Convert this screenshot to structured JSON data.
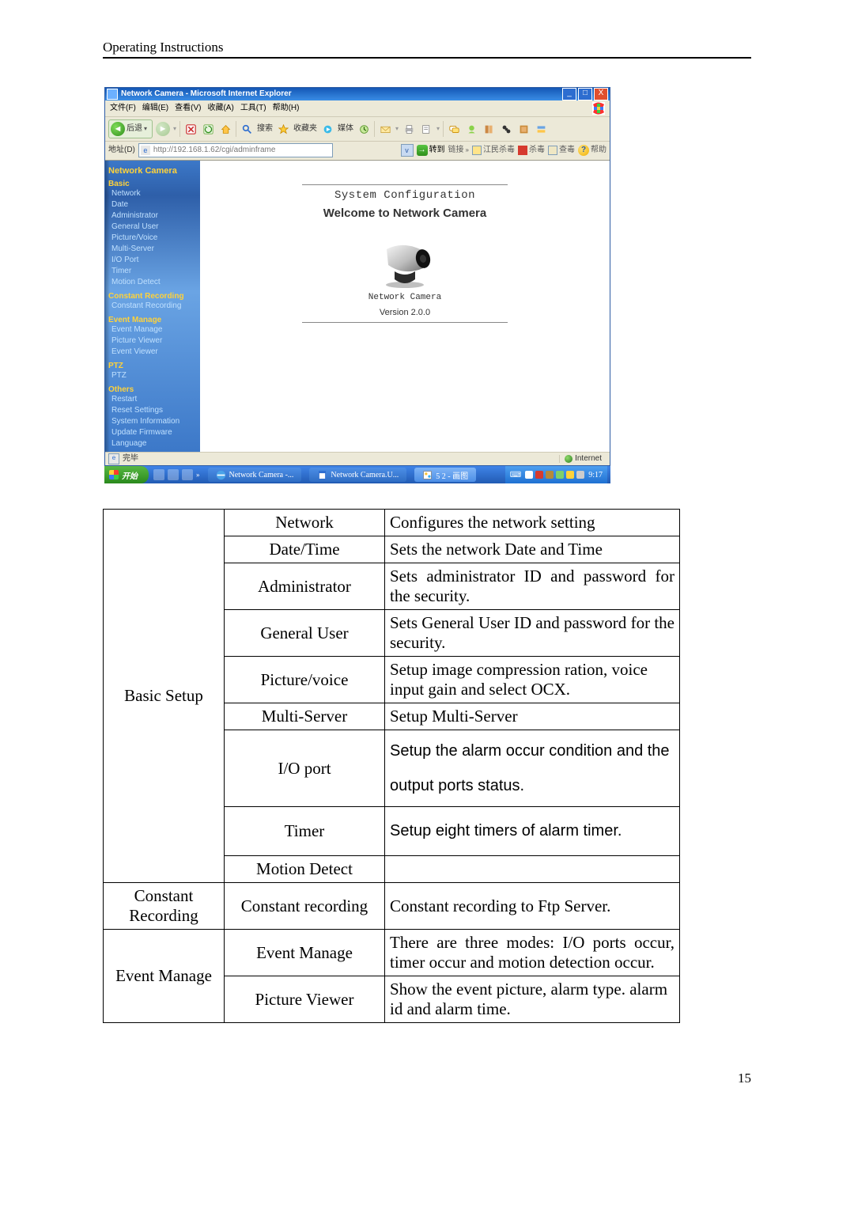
{
  "doc_header": "Operating Instructions",
  "page_number": "15",
  "window_title": "Network Camera - Microsoft Internet Explorer",
  "menu": {
    "file": "文件(F)",
    "edit": "编辑(E)",
    "view": "查看(V)",
    "fav": "收藏(A)",
    "tools": "工具(T)",
    "help": "帮助(H)"
  },
  "toolbar": {
    "back": "后退",
    "search": "搜索",
    "fav": "收藏夹",
    "media": "媒体"
  },
  "address": {
    "label": "地址(D)",
    "url": "http://192.168.1.62/cgi/adminframe",
    "go": "转到",
    "links": "链接",
    "jiang": "江民杀毒",
    "sha": "杀毒",
    "chak": "查毒",
    "help": "帮助"
  },
  "sidebar": {
    "title": "Network Camera",
    "sections": [
      {
        "header": "Basic",
        "items": [
          "Network",
          "Date",
          "Administrator",
          "General User",
          "Picture/Voice",
          "Multi-Server",
          "I/O Port",
          "Timer",
          "Motion Detect"
        ]
      },
      {
        "header": "Constant Recording",
        "items": [
          "Constant Recording"
        ]
      },
      {
        "header": "Event Manage",
        "items": [
          "Event Manage",
          "Picture Viewer",
          "Event Viewer"
        ]
      },
      {
        "header": "PTZ",
        "items": [
          "PTZ"
        ]
      },
      {
        "header": "Others",
        "items": [
          "Restart",
          "Reset Settings",
          "System Information",
          "Update Firmware",
          "Language"
        ]
      }
    ]
  },
  "main": {
    "title": "System Configuration",
    "welcome": "Welcome to Network Camera",
    "caption": "Network Camera",
    "version": "Version 2.0.0"
  },
  "status": {
    "done": "完毕",
    "zone": "Internet"
  },
  "taskbar": {
    "start": "开始",
    "task1": "Network Camera -...",
    "task2": "Network Camera.U...",
    "task3": "5 2 - 画图",
    "clock": "9:17"
  },
  "table": {
    "rows": [
      {
        "group": "Basic Setup",
        "item": "Network",
        "desc": "Configures the network setting"
      },
      {
        "group": "Basic Setup",
        "item": "Date/Time",
        "desc": "Sets the network Date and Time"
      },
      {
        "group": "Basic Setup",
        "item": "Administrator",
        "desc": "Sets administrator ID and password for the security."
      },
      {
        "group": "Basic Setup",
        "item": "General User",
        "desc": "Sets General User ID and password for the security."
      },
      {
        "group": "Basic Setup",
        "item": "Picture/voice",
        "desc": "Setup image compression ration, voice input gain and select OCX."
      },
      {
        "group": "Basic Setup",
        "item": "Multi-Server",
        "desc": "Setup Multi-Server"
      },
      {
        "group": "Basic Setup",
        "item": "I/O port",
        "desc": "Setup the alarm occur condition and the output ports status."
      },
      {
        "group": "Basic Setup",
        "item": "Timer",
        "desc": "Setup eight timers of alarm timer."
      },
      {
        "group": "Basic Setup",
        "item": "Motion Detect",
        "desc": ""
      },
      {
        "group": "Constant Recording",
        "item": "Constant recording",
        "desc": "Constant recording to Ftp Server."
      },
      {
        "group": "Event Manage",
        "item": "Event Manage",
        "desc": "There are three modes: I/O ports occur, timer occur and motion detection occur."
      },
      {
        "group": "Event Manage",
        "item": "Picture Viewer",
        "desc": "Show the event picture, alarm type. alarm id and alarm time."
      }
    ]
  }
}
